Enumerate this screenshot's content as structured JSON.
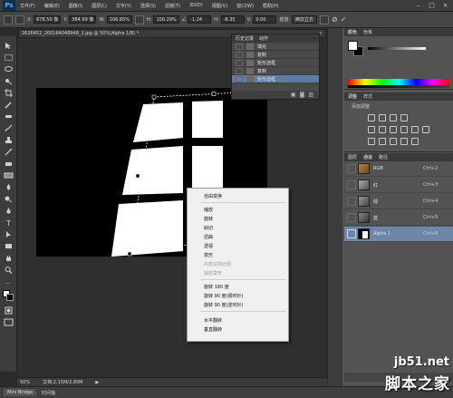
{
  "app": {
    "logo": "Ps",
    "menus": [
      "文件(F)",
      "编辑(E)",
      "图像(I)",
      "图层(L)",
      "文字(Y)",
      "选择(S)",
      "滤镜(T)",
      "3D(D)",
      "视图(V)",
      "窗口(W)",
      "帮助(H)"
    ]
  },
  "options_bar": {
    "x_label": "X:",
    "x_value": "678.50 像",
    "y_label": "Y:",
    "y_value": "384.99 像",
    "w_label": "W:",
    "w_value": "106.65%",
    "h_label": "H:",
    "h_value": "100.29%",
    "angle_value": "-1.24",
    "h_skew_label": "H:",
    "h_skew_value": "-8.35",
    "v_skew_label": "V:",
    "v_skew_value": "0.00",
    "interp_label": "插值:",
    "interp_value": "两次立方"
  },
  "document": {
    "tab_title": "2626452_200164048948_2.jpg @ 50%(Alpha 1/8) *",
    "zoom": "50%",
    "doc_info": "文档:2.15M/2.80M"
  },
  "history_panel": {
    "tabs": [
      "历史记录",
      "动作"
    ],
    "items": [
      {
        "label": "填充",
        "active": false
      },
      {
        "label": "复制",
        "active": false
      },
      {
        "label": "矩形选框",
        "active": false
      },
      {
        "label": "复制",
        "active": false
      },
      {
        "label": "矩形选框",
        "active": true
      }
    ]
  },
  "color_panel": {
    "tabs": [
      "颜色",
      "色板"
    ],
    "fg_color": "#ffffff",
    "bg_color": "#000000"
  },
  "adjustments_panel": {
    "tabs": [
      "调整",
      "样式"
    ],
    "title": "添加调整"
  },
  "channels_panel": {
    "tabs": [
      "图层",
      "通道",
      "路径"
    ],
    "channels": [
      {
        "name": "RGB",
        "key": "Ctrl+2",
        "active": false,
        "thumb": "rgb"
      },
      {
        "name": "红",
        "key": "Ctrl+3",
        "active": false,
        "thumb": "gray"
      },
      {
        "name": "绿",
        "key": "Ctrl+4",
        "active": false,
        "thumb": "gray"
      },
      {
        "name": "蓝",
        "key": "Ctrl+5",
        "active": false,
        "thumb": "gray"
      },
      {
        "name": "Alpha 1",
        "key": "Ctrl+6",
        "active": true,
        "thumb": "alpha"
      }
    ]
  },
  "context_menu": {
    "items": [
      {
        "label": "自由变换",
        "disabled": false
      },
      {
        "label": "缩放",
        "disabled": false
      },
      {
        "label": "旋转",
        "disabled": false
      },
      {
        "label": "斜切",
        "disabled": false
      },
      {
        "label": "扭曲",
        "disabled": false
      },
      {
        "label": "透视",
        "disabled": false
      },
      {
        "label": "变形",
        "disabled": false
      },
      {
        "label": "内容识别比例",
        "disabled": true
      },
      {
        "label": "操控变形",
        "disabled": true
      },
      {
        "label": "旋转 180 度",
        "disabled": false
      },
      {
        "label": "旋转 90 度(顺时针)",
        "disabled": false
      },
      {
        "label": "旋转 90 度(逆时针)",
        "disabled": false
      },
      {
        "label": "水平翻转",
        "disabled": false
      },
      {
        "label": "垂直翻转",
        "disabled": false
      }
    ]
  },
  "bottom_bar": {
    "tabs": [
      "Mini Bridge",
      "时间轴"
    ]
  },
  "watermark": {
    "url": "jb51.net",
    "name": "脚本之家"
  }
}
